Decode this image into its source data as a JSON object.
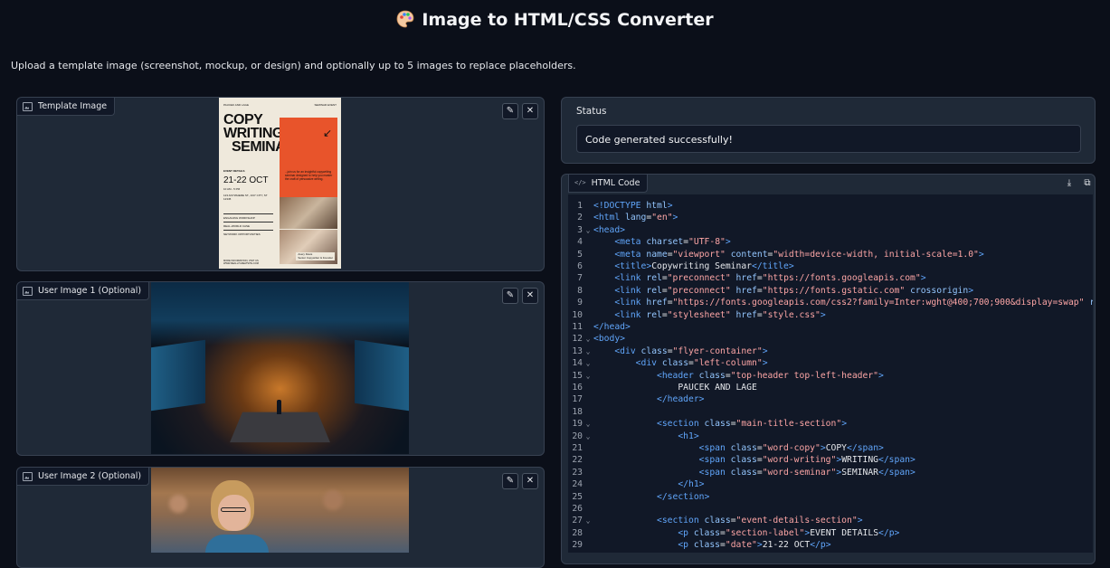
{
  "header": {
    "title": "Image to HTML/CSS Converter",
    "icon": "palette-icon"
  },
  "subtitle": "Upload a template image (screenshot, mockup, or design) and optionally up to 5 images to replace placeholders.",
  "template_panel": {
    "label": "Template Image",
    "poster": {
      "top_left": "PAUCEK AND LAGE",
      "top_right": "SEMINAR EVENT",
      "line1": "COPY",
      "line2": "WRITING",
      "line3": "SEMINAR",
      "tagline": "...join us for an insightful copywriting seminar designed to help you master the craft of persuasive writing.",
      "section_label": "EVENT DETAILS",
      "date": "21-22 OCT",
      "time": "10 AM - 5 PM",
      "address": "123 ANYWHERE ST., ANY CITY, ST 12345",
      "list": [
        "ENGAGING WORKSHOP",
        "REAL-WORLD CASE",
        "NETWORK OPPORTUNITIES"
      ],
      "speaker_name": "Avery Davis",
      "speaker_role": "Senior Copywriter & Founder",
      "footer": "MORE INFORMATION, VISIT US WWW.REALLYGREATSITE.COM"
    }
  },
  "user_image_1": {
    "label": "User Image 1 (Optional)"
  },
  "user_image_2": {
    "label": "User Image 2 (Optional)"
  },
  "status": {
    "label": "Status",
    "value": "Code generated successfully!"
  },
  "code_panel": {
    "label": "HTML Code",
    "lines": [
      {
        "n": "1",
        "f": "",
        "c": "<!DOCTYPE html>"
      },
      {
        "n": "2",
        "f": "",
        "c": "<html lang=\"en\">"
      },
      {
        "n": "3",
        "f": "⌄",
        "c": "<head>"
      },
      {
        "n": "4",
        "f": "",
        "c": "    <meta charset=\"UTF-8\">"
      },
      {
        "n": "5",
        "f": "",
        "c": "    <meta name=\"viewport\" content=\"width=device-width, initial-scale=1.0\">"
      },
      {
        "n": "6",
        "f": "",
        "c": "    <title>Copywriting Seminar</title>"
      },
      {
        "n": "7",
        "f": "",
        "c": "    <link rel=\"preconnect\" href=\"https://fonts.googleapis.com\">"
      },
      {
        "n": "8",
        "f": "",
        "c": "    <link rel=\"preconnect\" href=\"https://fonts.gstatic.com\" crossorigin>"
      },
      {
        "n": "9",
        "f": "",
        "c": "    <link href=\"https://fonts.googleapis.com/css2?family=Inter:wght@400;700;900&display=swap\" re"
      },
      {
        "n": "10",
        "f": "",
        "c": "    <link rel=\"stylesheet\" href=\"style.css\">"
      },
      {
        "n": "11",
        "f": "",
        "c": "</head>"
      },
      {
        "n": "12",
        "f": "⌄",
        "c": "<body>"
      },
      {
        "n": "13",
        "f": "⌄",
        "c": "    <div class=\"flyer-container\">"
      },
      {
        "n": "14",
        "f": "⌄",
        "c": "        <div class=\"left-column\">"
      },
      {
        "n": "15",
        "f": "⌄",
        "c": "            <header class=\"top-header top-left-header\">"
      },
      {
        "n": "16",
        "f": "",
        "c": "                PAUCEK AND LAGE"
      },
      {
        "n": "17",
        "f": "",
        "c": "            </header>"
      },
      {
        "n": "18",
        "f": "",
        "c": ""
      },
      {
        "n": "19",
        "f": "⌄",
        "c": "            <section class=\"main-title-section\">"
      },
      {
        "n": "20",
        "f": "⌄",
        "c": "                <h1>"
      },
      {
        "n": "21",
        "f": "",
        "c": "                    <span class=\"word-copy\">COPY</span>"
      },
      {
        "n": "22",
        "f": "",
        "c": "                    <span class=\"word-writing\">WRITING</span>"
      },
      {
        "n": "23",
        "f": "",
        "c": "                    <span class=\"word-seminar\">SEMINAR</span>"
      },
      {
        "n": "24",
        "f": "",
        "c": "                </h1>"
      },
      {
        "n": "25",
        "f": "",
        "c": "            </section>"
      },
      {
        "n": "26",
        "f": "",
        "c": ""
      },
      {
        "n": "27",
        "f": "⌄",
        "c": "            <section class=\"event-details-section\">"
      },
      {
        "n": "28",
        "f": "",
        "c": "                <p class=\"section-label\">EVENT DETAILS</p>"
      },
      {
        "n": "29",
        "f": "",
        "c": "                <p class=\"date\">21-22 OCT</p>"
      }
    ]
  },
  "colors": {
    "bg": "#0b0f19",
    "panel": "#1f2937",
    "accent_orange": "#e8542b",
    "tag": "#60a5fa",
    "attr": "#93c5fd",
    "string": "#fca5a5"
  }
}
